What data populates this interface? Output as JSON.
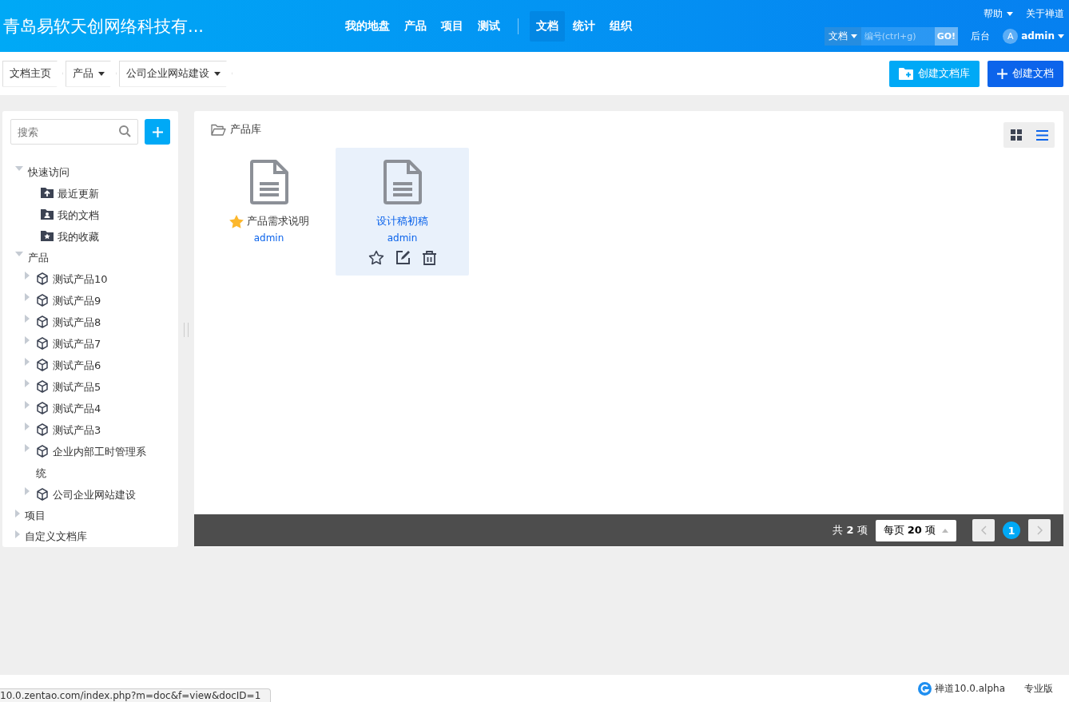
{
  "header": {
    "company": "青岛易软天创网络科技有...",
    "nav": [
      {
        "label": "我的地盘",
        "selected": false
      },
      {
        "label": "产品",
        "selected": false
      },
      {
        "label": "项目",
        "selected": false
      },
      {
        "label": "测试",
        "selected": false
      },
      {
        "label": "文档",
        "selected": true
      },
      {
        "label": "统计",
        "selected": false
      },
      {
        "label": "组织",
        "selected": false
      }
    ],
    "help": "帮助",
    "about": "关于禅道",
    "search_type": "文档",
    "search": {
      "placeholder": "编号(ctrl+g)"
    },
    "go": "GO!",
    "admin_link": "后台",
    "avatar": "A",
    "user": "admin"
  },
  "breadcrumb": [
    {
      "label": "文档主页",
      "dropdown": false
    },
    {
      "label": "产品",
      "dropdown": true
    },
    {
      "label": "公司企业网站建设",
      "dropdown": true
    }
  ],
  "actions": [
    {
      "label": "创建文档库",
      "kind": "library"
    },
    {
      "label": "创建文档",
      "kind": "doc"
    }
  ],
  "sidebar": {
    "search": {
      "placeholder": "搜索"
    },
    "tree": [
      {
        "label": "快速访问",
        "expanded": true,
        "children": [
          {
            "label": "最近更新",
            "kind": "recent"
          },
          {
            "label": "我的文档",
            "kind": "mine"
          },
          {
            "label": "我的收藏",
            "kind": "favorite"
          }
        ]
      },
      {
        "label": "产品",
        "expanded": true,
        "children": [
          {
            "label": "测试产品10",
            "kind": "product",
            "expanded": false
          },
          {
            "label": "测试产品9",
            "kind": "product",
            "expanded": false
          },
          {
            "label": "测试产品8",
            "kind": "product",
            "expanded": false
          },
          {
            "label": "测试产品7",
            "kind": "product",
            "expanded": false
          },
          {
            "label": "测试产品6",
            "kind": "product",
            "expanded": false
          },
          {
            "label": "测试产品5",
            "kind": "product",
            "expanded": false
          },
          {
            "label": "测试产品4",
            "kind": "product",
            "expanded": false
          },
          {
            "label": "测试产品3",
            "kind": "product",
            "expanded": false
          },
          {
            "label": "企业内部工时管理系统",
            "kind": "product",
            "expanded": false
          },
          {
            "label": "公司企业网站建设",
            "kind": "product",
            "expanded": false
          }
        ]
      },
      {
        "label": "项目",
        "expanded": false
      },
      {
        "label": "自定义文档库",
        "expanded": false
      }
    ]
  },
  "main": {
    "title": "产品库",
    "views": [
      {
        "kind": "grid",
        "selected": true
      },
      {
        "kind": "list",
        "selected": false
      }
    ],
    "docs": [
      {
        "title": "产品需求说明",
        "author": "admin",
        "starred": true,
        "hovered": false
      },
      {
        "title": "设计稿初稿",
        "author": "admin",
        "starred": false,
        "hovered": true
      }
    ],
    "pager": {
      "total": "共 **2** 项",
      "per_page": "每页 **20** 项",
      "pages": [
        {
          "label": "1",
          "selected": true
        }
      ]
    }
  },
  "footer": {
    "status_url": "10.0.zentao.com/index.php?m=doc&f=view&docID=1",
    "version": "禅道10.0.alpha",
    "edition": "专业版"
  }
}
